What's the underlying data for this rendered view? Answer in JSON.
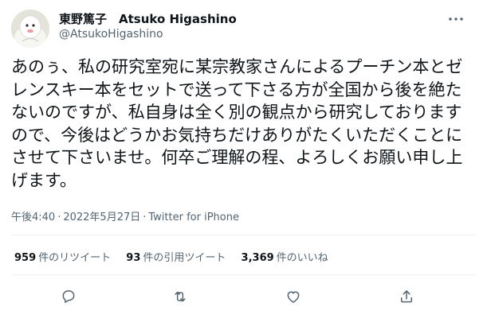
{
  "author": {
    "name": "東野篤子　Atsuko Higashino",
    "handle": "@AtsukoHigashino"
  },
  "tweet": {
    "text": "あのぅ、私の研究室宛に某宗教家さんによるプーチン本とゼレンスキー本をセットで送って下さる方が全国から後を絶たないのですが、私自身は全く別の観点から研究しておりますので、今後はどうかお気持ちだけありがたくいただくことにさせて下さいませ。何卒ご理解の程、よろしくお願い申し上げます。",
    "time": "午後4:40",
    "date": "2022年5月27日",
    "source": "Twitter for iPhone",
    "separator": "·"
  },
  "stats": {
    "retweets_count": "959",
    "retweets_label": "件のリツイート",
    "quotes_count": "93",
    "quotes_label": "件の引用ツイート",
    "likes_count": "3,369",
    "likes_label": "件のいいね"
  },
  "icons": {
    "avatar": "avatar-character",
    "more": "more-dots-icon",
    "reply": "reply-icon",
    "retweet": "retweet-icon",
    "like": "heart-icon",
    "share": "share-icon"
  },
  "colors": {
    "text": "#0f1419",
    "secondary": "#536471",
    "divider": "#eff3f4"
  }
}
